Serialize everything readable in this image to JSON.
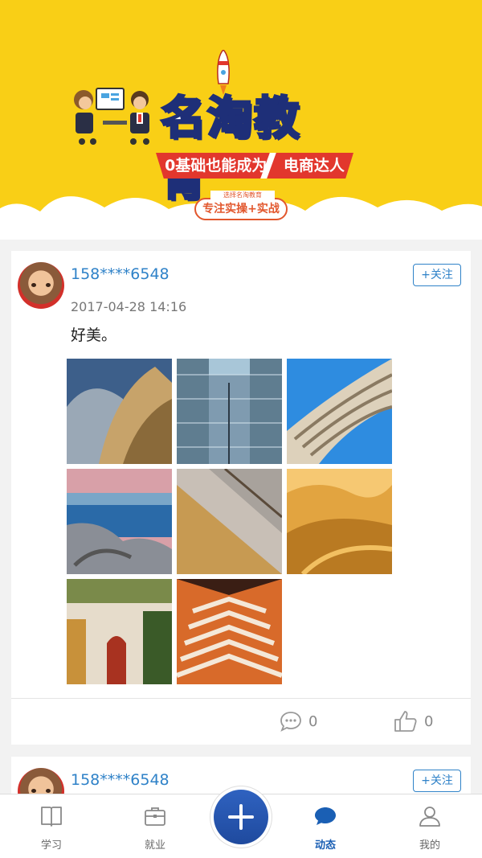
{
  "banner": {
    "brand_title": "名淘教育",
    "ribbon_text": "0基础也能成为",
    "ribbon_text_2": "电商达人",
    "tagline": "选择名淘教育",
    "pill_text": "专注实操+实战"
  },
  "posts": [
    {
      "username": "158****6548",
      "follow_label": "+关注",
      "timestamp": "2017-04-28 14:16",
      "content": "好美。",
      "comments": "0",
      "likes": "0"
    },
    {
      "username": "158****6548",
      "follow_label": "+关注"
    }
  ],
  "tabbar": {
    "tabs": [
      {
        "label": "学习",
        "icon": "book-icon"
      },
      {
        "label": "就业",
        "icon": "briefcase-icon"
      },
      {
        "label": "动态",
        "icon": "chat-bubble-icon"
      },
      {
        "label": "我的",
        "icon": "person-icon"
      }
    ],
    "active": "动态",
    "accent": "#1a5fb4"
  },
  "colors": {
    "banner_yellow": "#f9cf16",
    "link_blue": "#2f82c8",
    "fab_blue": "#2f62c0",
    "ribbon_red": "#e2372d"
  }
}
